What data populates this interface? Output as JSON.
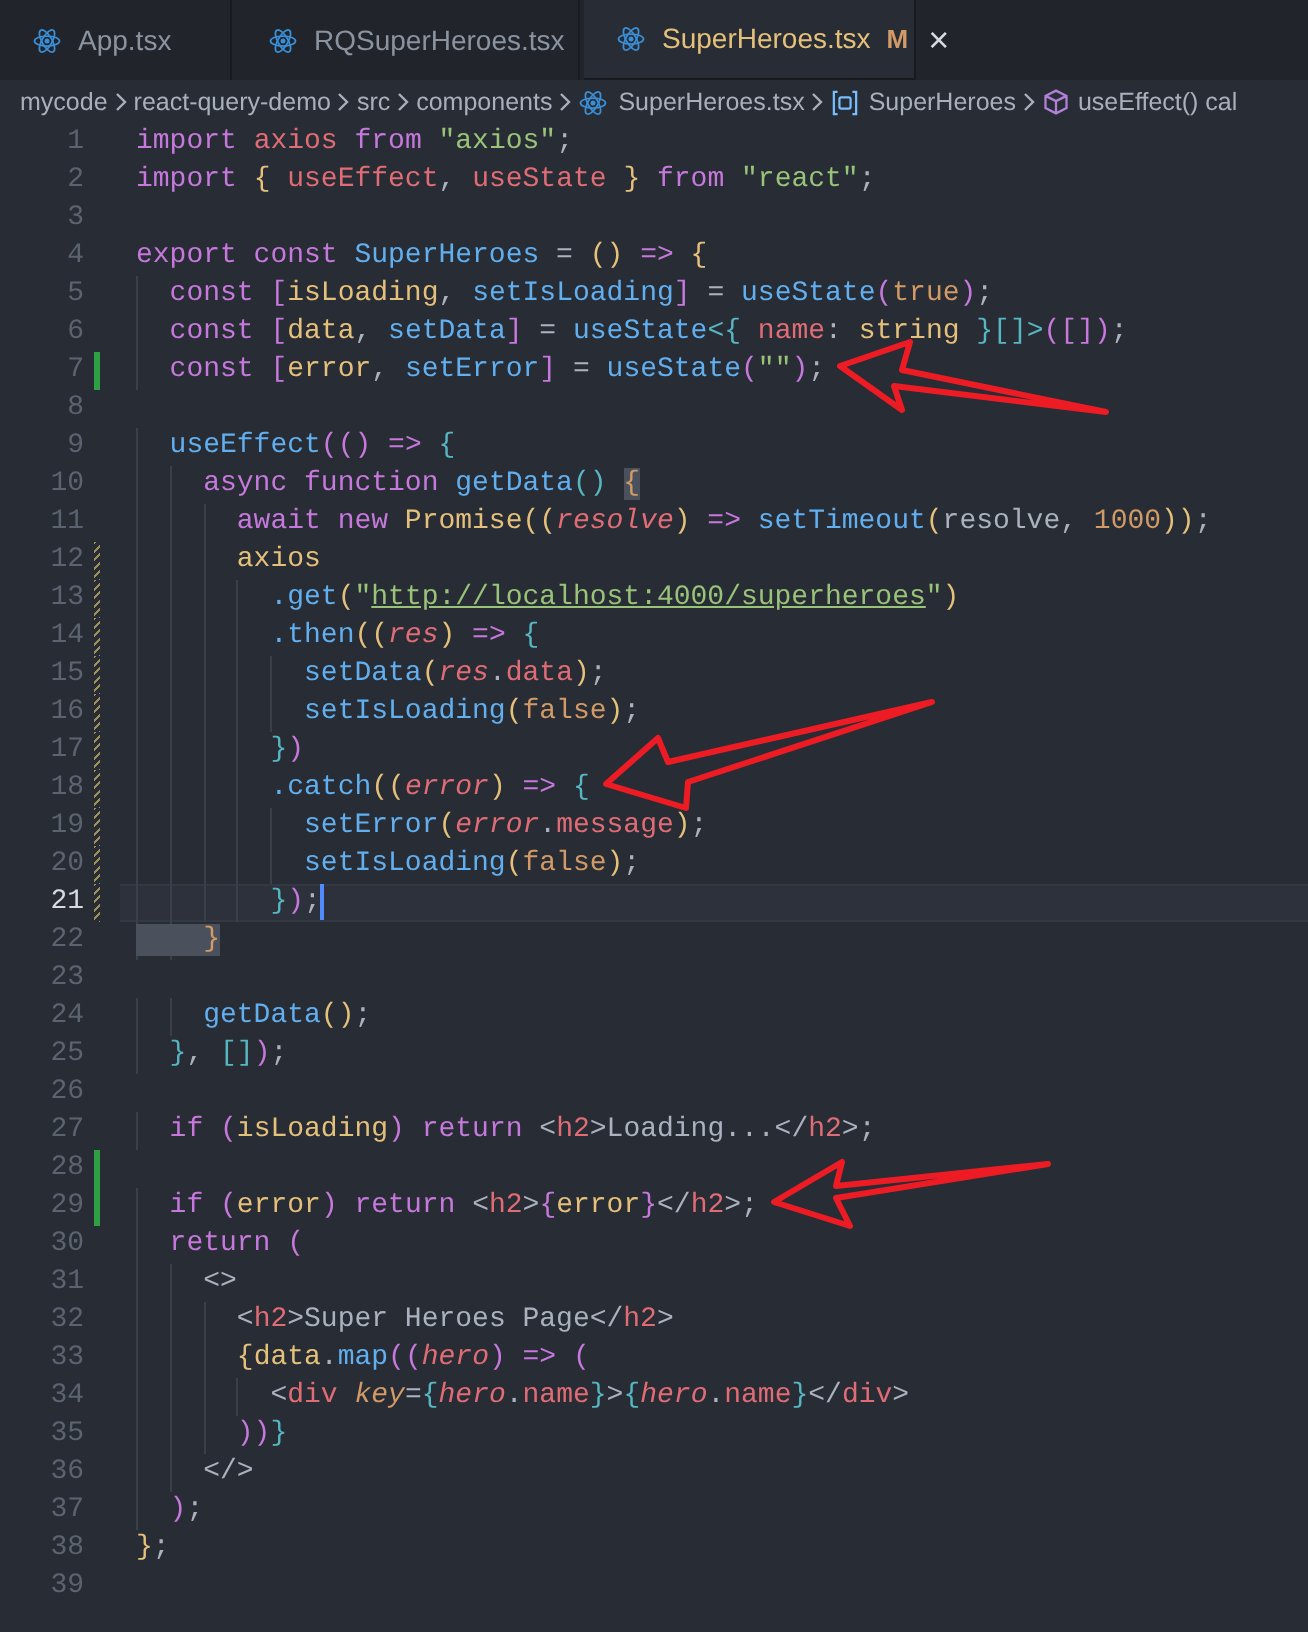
{
  "tabs": [
    {
      "label": "App.tsx",
      "selected": false,
      "modified": false
    },
    {
      "label": "RQSuperHeroes.tsx",
      "selected": false,
      "modified": false
    },
    {
      "label": "SuperHeroes.tsx",
      "selected": true,
      "modified": true,
      "badge": "M",
      "close": "×"
    }
  ],
  "breadcrumb": [
    {
      "kind": "folder",
      "text": "mycode"
    },
    {
      "kind": "folder",
      "text": "react-query-demo"
    },
    {
      "kind": "folder",
      "text": "src"
    },
    {
      "kind": "folder",
      "text": "components"
    },
    {
      "kind": "file",
      "text": "SuperHeroes.tsx"
    },
    {
      "kind": "module",
      "text": "SuperHeroes"
    },
    {
      "kind": "method",
      "text": "useEffect() cal"
    }
  ],
  "lines": [
    {
      "n": "1",
      "kind": "unchanged",
      "current": false,
      "tokens": [
        {
          "kind": "kw",
          "text": "import "
        },
        {
          "kind": "var",
          "text": "axios "
        },
        {
          "kind": "kw",
          "text": "from "
        },
        {
          "kind": "str",
          "text": "\"axios\""
        },
        {
          "kind": "plain",
          "text": ";"
        }
      ]
    },
    {
      "n": "2",
      "kind": "unchanged",
      "current": false,
      "tokens": [
        {
          "kind": "kw",
          "text": "import "
        },
        {
          "kind": "b1",
          "text": "{ "
        },
        {
          "kind": "var",
          "text": "useEffect"
        },
        {
          "kind": "plain",
          "text": ", "
        },
        {
          "kind": "var",
          "text": "useState "
        },
        {
          "kind": "b1",
          "text": "} "
        },
        {
          "kind": "kw",
          "text": "from "
        },
        {
          "kind": "str",
          "text": "\"react\""
        },
        {
          "kind": "plain",
          "text": ";"
        }
      ]
    },
    {
      "n": "3",
      "kind": "unchanged",
      "current": false
    },
    {
      "n": "4",
      "kind": "unchanged",
      "current": false,
      "tokens": [
        {
          "kind": "kw",
          "text": "export const "
        },
        {
          "kind": "fn",
          "text": "SuperHeroes"
        },
        {
          "kind": "plain",
          "text": " = "
        },
        {
          "kind": "b1",
          "text": "()"
        },
        {
          "kind": "kw",
          "text": " => "
        },
        {
          "kind": "b1",
          "text": "{"
        }
      ]
    },
    {
      "n": "5",
      "kind": "unchanged",
      "current": false,
      "tokens": [
        {
          "kind": "kw",
          "text": "  const "
        },
        {
          "kind": "b2",
          "text": "["
        },
        {
          "kind": "vy",
          "text": "isLoading"
        },
        {
          "kind": "plain",
          "text": ", "
        },
        {
          "kind": "fn",
          "text": "setIsLoading"
        },
        {
          "kind": "b2",
          "text": "]"
        },
        {
          "kind": "plain",
          "text": " = "
        },
        {
          "kind": "fn",
          "text": "useState"
        },
        {
          "kind": "b2",
          "text": "("
        },
        {
          "kind": "num",
          "text": "true"
        },
        {
          "kind": "b2",
          "text": ")"
        },
        {
          "kind": "plain",
          "text": ";"
        }
      ]
    },
    {
      "n": "6",
      "kind": "unchanged",
      "current": false,
      "tokens": [
        {
          "kind": "kw",
          "text": "  const "
        },
        {
          "kind": "b2",
          "text": "["
        },
        {
          "kind": "vy",
          "text": "data"
        },
        {
          "kind": "plain",
          "text": ", "
        },
        {
          "kind": "fn",
          "text": "setData"
        },
        {
          "kind": "b2",
          "text": "]"
        },
        {
          "kind": "plain",
          "text": " = "
        },
        {
          "kind": "fn",
          "text": "useState"
        },
        {
          "kind": "cyan",
          "text": "<"
        },
        {
          "kind": "b3",
          "text": "{ "
        },
        {
          "kind": "var",
          "text": "name"
        },
        {
          "kind": "plain",
          "text": ": "
        },
        {
          "kind": "type",
          "text": "string "
        },
        {
          "kind": "b3",
          "text": "}[]"
        },
        {
          "kind": "cyan",
          "text": ">"
        },
        {
          "kind": "b2",
          "text": "([])"
        },
        {
          "kind": "plain",
          "text": ";"
        }
      ]
    },
    {
      "n": "7",
      "kind": "added",
      "current": false,
      "arrow": true,
      "tokens": [
        {
          "kind": "kw",
          "text": "  const "
        },
        {
          "kind": "b2",
          "text": "["
        },
        {
          "kind": "vy",
          "text": "error"
        },
        {
          "kind": "plain",
          "text": ", "
        },
        {
          "kind": "fn",
          "text": "setError"
        },
        {
          "kind": "b2",
          "text": "]"
        },
        {
          "kind": "plain",
          "text": " = "
        },
        {
          "kind": "fn",
          "text": "useState"
        },
        {
          "kind": "b2",
          "text": "("
        },
        {
          "kind": "str",
          "text": "\"\""
        },
        {
          "kind": "b2",
          "text": ")"
        },
        {
          "kind": "plain",
          "text": ";"
        }
      ]
    },
    {
      "n": "8",
      "kind": "unchanged",
      "current": false
    },
    {
      "n": "9",
      "kind": "unchanged",
      "current": false,
      "tokens": [
        {
          "kind": "fn",
          "text": "  useEffect"
        },
        {
          "kind": "b2",
          "text": "(()"
        },
        {
          "kind": "kw",
          "text": " => "
        },
        {
          "kind": "b3",
          "text": "{"
        }
      ]
    },
    {
      "n": "10",
      "kind": "unchanged",
      "current": false,
      "tokens": [
        {
          "kind": "kw",
          "text": "    async function "
        },
        {
          "kind": "fn",
          "text": "getData"
        },
        {
          "kind": "b3",
          "text": "() "
        },
        {
          "kind": "match",
          "text": "{"
        }
      ]
    },
    {
      "n": "11",
      "kind": "unchanged",
      "current": false,
      "tokens": [
        {
          "kind": "kw",
          "text": "      await new "
        },
        {
          "kind": "type",
          "text": "Promise"
        },
        {
          "kind": "b1",
          "text": "(("
        },
        {
          "kind": "param",
          "text": "resolve"
        },
        {
          "kind": "b1",
          "text": ")"
        },
        {
          "kind": "kw",
          "text": " => "
        },
        {
          "kind": "fn",
          "text": "setTimeout"
        },
        {
          "kind": "b1",
          "text": "("
        },
        {
          "kind": "plain",
          "text": "resolve, "
        },
        {
          "kind": "num",
          "text": "1000"
        },
        {
          "kind": "b1",
          "text": "))"
        },
        {
          "kind": "plain",
          "text": ";"
        }
      ]
    },
    {
      "n": "12",
      "kind": "modified",
      "current": false,
      "tokens": [
        {
          "kind": "vy",
          "text": "      axios"
        }
      ]
    },
    {
      "n": "13",
      "kind": "modified",
      "current": false,
      "tokens": [
        {
          "kind": "fn",
          "text": "        .get"
        },
        {
          "kind": "b1",
          "text": "("
        },
        {
          "kind": "str",
          "text": "\""
        },
        {
          "kind": "url",
          "text": "http://localhost:4000/superheroes"
        },
        {
          "kind": "str",
          "text": "\""
        },
        {
          "kind": "b1",
          "text": ")"
        }
      ]
    },
    {
      "n": "14",
      "kind": "modified",
      "current": false,
      "tokens": [
        {
          "kind": "fn",
          "text": "        .then"
        },
        {
          "kind": "b1",
          "text": "(("
        },
        {
          "kind": "param",
          "text": "res"
        },
        {
          "kind": "b1",
          "text": ")"
        },
        {
          "kind": "kw",
          "text": " => "
        },
        {
          "kind": "b3",
          "text": "{"
        }
      ]
    },
    {
      "n": "15",
      "kind": "modified",
      "current": false,
      "tokens": [
        {
          "kind": "fn",
          "text": "          setData"
        },
        {
          "kind": "b1",
          "text": "("
        },
        {
          "kind": "param",
          "text": "res"
        },
        {
          "kind": "plain",
          "text": "."
        },
        {
          "kind": "var",
          "text": "data"
        },
        {
          "kind": "b1",
          "text": ")"
        },
        {
          "kind": "plain",
          "text": ";"
        }
      ]
    },
    {
      "n": "16",
      "kind": "modified",
      "current": false,
      "tokens": [
        {
          "kind": "fn",
          "text": "          setIsLoading"
        },
        {
          "kind": "b1",
          "text": "("
        },
        {
          "kind": "num",
          "text": "false"
        },
        {
          "kind": "b1",
          "text": ")"
        },
        {
          "kind": "plain",
          "text": ";"
        }
      ]
    },
    {
      "n": "17",
      "kind": "modified",
      "current": false,
      "tokens": [
        {
          "kind": "b3",
          "text": "        }"
        },
        {
          "kind": "b2",
          "text": ")"
        }
      ]
    },
    {
      "n": "18",
      "kind": "modified",
      "current": false,
      "arrow": true,
      "tokens": [
        {
          "kind": "fn",
          "text": "        .catch"
        },
        {
          "kind": "b1",
          "text": "(("
        },
        {
          "kind": "param",
          "text": "error"
        },
        {
          "kind": "b1",
          "text": ")"
        },
        {
          "kind": "kw",
          "text": " => "
        },
        {
          "kind": "b3",
          "text": "{"
        }
      ]
    },
    {
      "n": "19",
      "kind": "modified",
      "current": false,
      "tokens": [
        {
          "kind": "fn",
          "text": "          setError"
        },
        {
          "kind": "b1",
          "text": "("
        },
        {
          "kind": "param",
          "text": "error"
        },
        {
          "kind": "plain",
          "text": "."
        },
        {
          "kind": "var",
          "text": "message"
        },
        {
          "kind": "b1",
          "text": ")"
        },
        {
          "kind": "plain",
          "text": ";"
        }
      ]
    },
    {
      "n": "20",
      "kind": "modified",
      "current": false,
      "tokens": [
        {
          "kind": "fn",
          "text": "          setIsLoading"
        },
        {
          "kind": "b1",
          "text": "("
        },
        {
          "kind": "num",
          "text": "false"
        },
        {
          "kind": "b1",
          "text": ")"
        },
        {
          "kind": "plain",
          "text": ";"
        }
      ]
    },
    {
      "n": "21",
      "kind": "modified",
      "current": true,
      "tokens": [
        {
          "kind": "b3",
          "text": "        }"
        },
        {
          "kind": "b2",
          "text": ")"
        },
        {
          "kind": "plain",
          "text": ";"
        }
      ]
    },
    {
      "n": "22",
      "kind": "unchanged",
      "current": false,
      "tokens": [
        {
          "kind": "match",
          "text": "    }"
        }
      ]
    },
    {
      "n": "23",
      "kind": "unchanged",
      "current": false
    },
    {
      "n": "24",
      "kind": "unchanged",
      "current": false,
      "tokens": [
        {
          "kind": "fn",
          "text": "    getData"
        },
        {
          "kind": "b1",
          "text": "()"
        },
        {
          "kind": "plain",
          "text": ";"
        }
      ]
    },
    {
      "n": "25",
      "kind": "unchanged",
      "current": false,
      "tokens": [
        {
          "kind": "b3",
          "text": "  }"
        },
        {
          "kind": "plain",
          "text": ", "
        },
        {
          "kind": "cyan",
          "text": "[]"
        },
        {
          "kind": "b2",
          "text": ")"
        },
        {
          "kind": "plain",
          "text": ";"
        }
      ]
    },
    {
      "n": "26",
      "kind": "unchanged",
      "current": false
    },
    {
      "n": "27",
      "kind": "unchanged",
      "current": false,
      "tokens": [
        {
          "kind": "kw",
          "text": "  if "
        },
        {
          "kind": "b2",
          "text": "("
        },
        {
          "kind": "vy",
          "text": "isLoading"
        },
        {
          "kind": "b2",
          "text": ")"
        },
        {
          "kind": "kw",
          "text": " return "
        },
        {
          "kind": "plain",
          "text": "<"
        },
        {
          "kind": "var",
          "text": "h2"
        },
        {
          "kind": "plain",
          "text": ">Loading...</"
        },
        {
          "kind": "var",
          "text": "h2"
        },
        {
          "kind": "plain",
          "text": ">;"
        }
      ]
    },
    {
      "n": "28",
      "kind": "added",
      "current": false
    },
    {
      "n": "29",
      "kind": "added",
      "current": false,
      "arrow": true,
      "tokens": [
        {
          "kind": "kw",
          "text": "  if "
        },
        {
          "kind": "b2",
          "text": "("
        },
        {
          "kind": "vy",
          "text": "error"
        },
        {
          "kind": "b2",
          "text": ")"
        },
        {
          "kind": "kw",
          "text": " return "
        },
        {
          "kind": "plain",
          "text": "<"
        },
        {
          "kind": "var",
          "text": "h2"
        },
        {
          "kind": "plain",
          "text": ">"
        },
        {
          "kind": "b2",
          "text": "{"
        },
        {
          "kind": "vy",
          "text": "error"
        },
        {
          "kind": "b2",
          "text": "}"
        },
        {
          "kind": "plain",
          "text": "</"
        },
        {
          "kind": "var",
          "text": "h2"
        },
        {
          "kind": "plain",
          "text": ">;"
        }
      ]
    },
    {
      "n": "30",
      "kind": "unchanged",
      "current": false,
      "tokens": [
        {
          "kind": "kw",
          "text": "  return "
        },
        {
          "kind": "b2",
          "text": "("
        }
      ]
    },
    {
      "n": "31",
      "kind": "unchanged",
      "current": false,
      "tokens": [
        {
          "kind": "plain",
          "text": "    <>"
        }
      ]
    },
    {
      "n": "32",
      "kind": "unchanged",
      "current": false,
      "tokens": [
        {
          "kind": "plain",
          "text": "      <"
        },
        {
          "kind": "var",
          "text": "h2"
        },
        {
          "kind": "plain",
          "text": ">Super Heroes Page</"
        },
        {
          "kind": "var",
          "text": "h2"
        },
        {
          "kind": "plain",
          "text": ">"
        }
      ]
    },
    {
      "n": "33",
      "kind": "unchanged",
      "current": false,
      "tokens": [
        {
          "kind": "b1",
          "text": "      {"
        },
        {
          "kind": "vy",
          "text": "data"
        },
        {
          "kind": "plain",
          "text": "."
        },
        {
          "kind": "fn",
          "text": "map"
        },
        {
          "kind": "b2",
          "text": "(("
        },
        {
          "kind": "param",
          "text": "hero"
        },
        {
          "kind": "b2",
          "text": ")"
        },
        {
          "kind": "kw",
          "text": " => "
        },
        {
          "kind": "b2",
          "text": "("
        }
      ]
    },
    {
      "n": "34",
      "kind": "unchanged",
      "current": false,
      "tokens": [
        {
          "kind": "plain",
          "text": "        <"
        },
        {
          "kind": "var",
          "text": "div "
        },
        {
          "kind": "attr",
          "text": "key"
        },
        {
          "kind": "plain",
          "text": "="
        },
        {
          "kind": "b3",
          "text": "{"
        },
        {
          "kind": "param",
          "text": "hero"
        },
        {
          "kind": "plain",
          "text": "."
        },
        {
          "kind": "var",
          "text": "name"
        },
        {
          "kind": "b3",
          "text": "}"
        },
        {
          "kind": "plain",
          "text": ">"
        },
        {
          "kind": "b3",
          "text": "{"
        },
        {
          "kind": "param",
          "text": "hero"
        },
        {
          "kind": "plain",
          "text": "."
        },
        {
          "kind": "var",
          "text": "name"
        },
        {
          "kind": "b3",
          "text": "}"
        },
        {
          "kind": "plain",
          "text": "</"
        },
        {
          "kind": "var",
          "text": "div"
        },
        {
          "kind": "plain",
          "text": ">"
        }
      ]
    },
    {
      "n": "35",
      "kind": "unchanged",
      "current": false,
      "tokens": [
        {
          "kind": "b2",
          "text": "      ))"
        },
        {
          "kind": "b3",
          "text": "}"
        }
      ]
    },
    {
      "n": "36",
      "kind": "unchanged",
      "current": false,
      "tokens": [
        {
          "kind": "plain",
          "text": "    </>"
        }
      ]
    },
    {
      "n": "37",
      "kind": "unchanged",
      "current": false,
      "tokens": [
        {
          "kind": "b2",
          "text": "  )"
        },
        {
          "kind": "plain",
          "text": ";"
        }
      ]
    },
    {
      "n": "38",
      "kind": "unchanged",
      "current": false,
      "tokens": [
        {
          "kind": "b1",
          "text": "}"
        },
        {
          "kind": "plain",
          "text": ";"
        }
      ]
    },
    {
      "n": "39",
      "kind": "unchanged",
      "current": false
    }
  ]
}
